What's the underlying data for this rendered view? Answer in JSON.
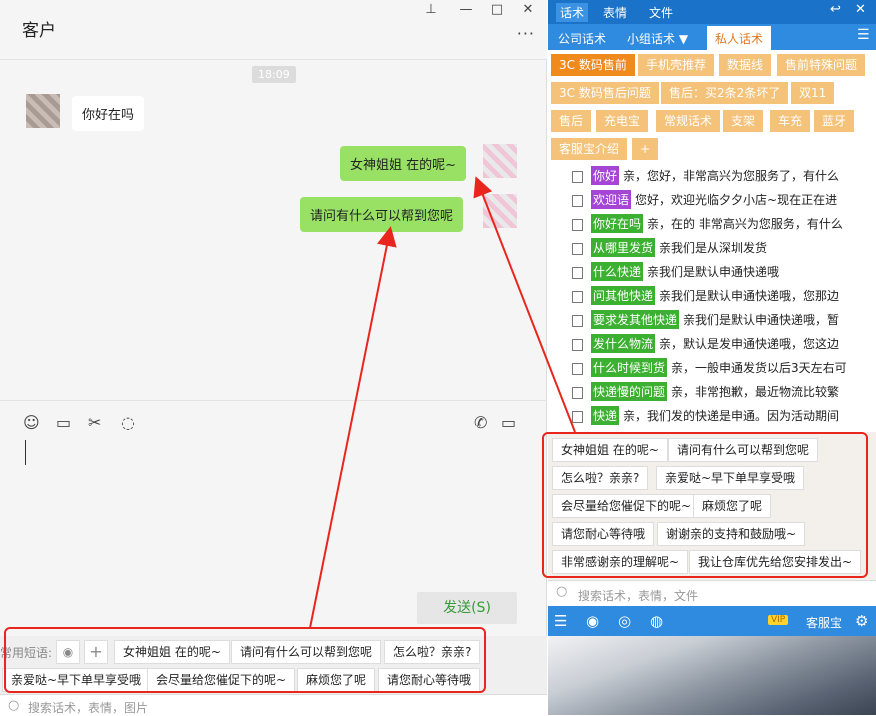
{
  "window": {
    "title": "客户",
    "pin_icon": "pin-icon",
    "min_icon": "minimize-icon",
    "max_icon": "maximize-icon",
    "close_icon": "close-icon",
    "more": "···"
  },
  "chat": {
    "time": "18:09",
    "incoming": "你好在吗",
    "outgoing": [
      "女神姐姐 在的呢~",
      "请问有什么可以帮到您呢"
    ]
  },
  "toolbar": {
    "icons": [
      "emoji-icon",
      "folder-icon",
      "scissors-icon",
      "chat-bubble-icon",
      "phone-icon",
      "video-icon"
    ]
  },
  "send_label": "发送(S)",
  "quick": {
    "label": "常用短语:",
    "row1": [
      "女神姐姐 在的呢~",
      "请问有什么可以帮到您呢",
      "怎么啦？亲亲?"
    ],
    "row2": [
      "亲爱哒~早下单早享受哦",
      "会尽量给您催促下的呢~",
      "麻烦您了呢",
      "请您耐心等待哦"
    ]
  },
  "search_left": {
    "placeholder": "搜索话术，表情，图片"
  },
  "right": {
    "tabs": [
      "话术",
      "表情",
      "文件"
    ],
    "subtabs": [
      "公司话术",
      "小组话术 ▼",
      "私人话术"
    ],
    "categories": [
      "3C 数码售前",
      "手机壳推荐",
      "数据线",
      "售前特殊问题",
      "3C 数码售后问题",
      "售后：买2条2条坏了",
      "双11",
      "售后",
      "充电宝",
      "常规话术",
      "支架",
      "车充",
      "蓝牙",
      "客服宝介绍",
      "+"
    ],
    "phrases": [
      {
        "tag": "你好",
        "text": "亲，您好，非常高兴为您服务了，有什么"
      },
      {
        "tag": "欢迎语",
        "text": "您好，欢迎光临夕夕小店~现在正在进"
      },
      {
        "tag": "你好在吗",
        "text": "亲，在的 非常高兴为您服务，有什么"
      },
      {
        "tag": "从哪里发货",
        "text": "亲我们是从深圳发货"
      },
      {
        "tag": "什么快递",
        "text": "亲我们是默认申通快递哦"
      },
      {
        "tag": "问其他快递",
        "text": "亲我们是默认申通快递哦，您那边"
      },
      {
        "tag": "要求发其他快递",
        "text": "亲我们是默认申通快递哦，暂"
      },
      {
        "tag": "发什么物流",
        "text": "亲，默认是发申通快递哦，您这边"
      },
      {
        "tag": "什么时候到货",
        "text": "亲，一般申通发货以后3天左右可"
      },
      {
        "tag": "快递慢的问题",
        "text": "亲，非常抱歉，最近物流比较繁"
      },
      {
        "tag": "快递",
        "text": "亲，我们发的快递是申通。因为活动期间"
      }
    ],
    "panel_chips": [
      "女神姐姐 在的呢~",
      "请问有什么可以帮到您呢",
      "怎么啦？亲亲?",
      "亲爱哒~早下单早享受哦",
      "会尽量给您催促下的呢~",
      "麻烦您了呢",
      "请您耐心等待哦",
      "谢谢亲的支持和鼓励哦~",
      "非常感谢亲的理解呢~",
      "我让仓库优先给您安排发出~"
    ],
    "search_placeholder": "搜索话术，表情，文件",
    "bottom": {
      "vip": "VIP",
      "label": "客服宝"
    }
  },
  "colors": {
    "accent": "#1a73c8",
    "green_bubble": "#98e165",
    "orange": "#f08a1c",
    "red_annotation": "#e8261d"
  }
}
